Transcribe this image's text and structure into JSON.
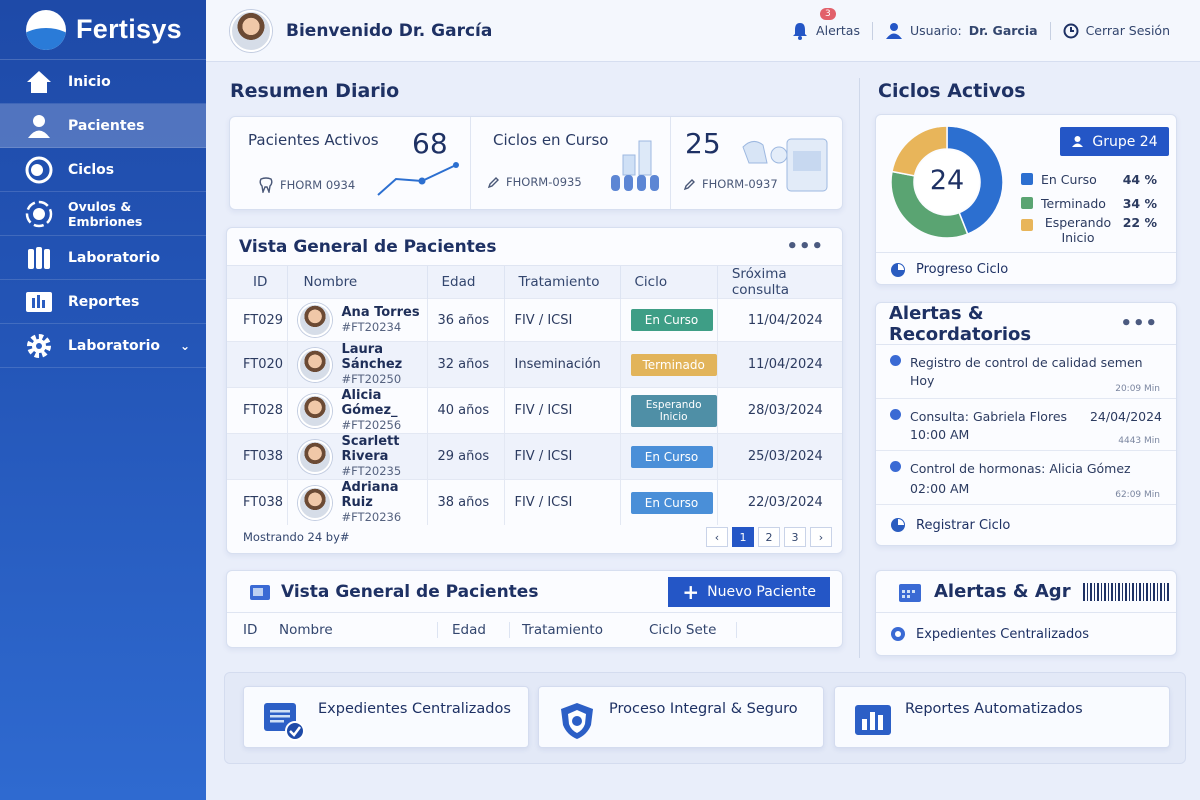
{
  "app": {
    "name": "Fertisys"
  },
  "sidebar": {
    "items": [
      {
        "label": "Inicio",
        "icon": "home-icon"
      },
      {
        "label": "Pacientes",
        "icon": "user-icon"
      },
      {
        "label": "Ciclos",
        "icon": "cycle-icon"
      },
      {
        "label": "Ovulos & Embriones",
        "icon": "embryo-icon"
      },
      {
        "label": "Laboratorio",
        "icon": "lab-icon"
      },
      {
        "label": "Reportes",
        "icon": "reports-icon"
      },
      {
        "label": "Laboratorio",
        "icon": "gear-icon"
      }
    ]
  },
  "header": {
    "welcome": "Bienvenido Dr. García",
    "alerts_label": "Alertas",
    "alerts_count": "3",
    "user_prefix": "Usuario:",
    "user_name": "Dr. Garcia",
    "logout": "Cerrar Sesión"
  },
  "summary": {
    "title": "Resumen Diario",
    "stats": [
      {
        "label": "Pacientes Activos",
        "value": "68",
        "code": "FHORM 0934"
      },
      {
        "label": "Ciclos en Curso",
        "value": "",
        "code": "FHORM-0935"
      },
      {
        "label": "",
        "value": "25",
        "code": "FHORM-0937"
      }
    ]
  },
  "patients": {
    "title": "Vista General de Pacientes",
    "columns": [
      "ID",
      "Nombre",
      "Edad",
      "Tratamiento",
      "Ciclo",
      "Sróxima consulta"
    ],
    "rows": [
      {
        "id": "FT029",
        "name": "Ana Torres",
        "code": "#FT20234",
        "age": "36 años",
        "treatment": "FIV / ICSI",
        "status": "En Curso",
        "date": "11/04/2024"
      },
      {
        "id": "FT020",
        "name": "Laura Sánchez",
        "code": "#FT20250",
        "age": "32 años",
        "treatment": "Inseminación",
        "status": "Terminado",
        "date": "11/04/2024"
      },
      {
        "id": "FT028",
        "name": "Alicia Gómez_",
        "code": "#FT20256",
        "age": "40 años",
        "treatment": "FIV / ICSI",
        "status": "Esperando Inicio",
        "date": "28/03/2024"
      },
      {
        "id": "FT038",
        "name": "Scarlett Rivera",
        "code": "#FT20235",
        "age": "29 años",
        "treatment": "FIV / ICSI",
        "status": "En Curso",
        "date": "25/03/2024"
      },
      {
        "id": "FT038",
        "name": "Adriana Ruiz",
        "code": "#FT20236",
        "age": "38 años",
        "treatment": "FIV / ICSI",
        "status": "En Curso",
        "date": "22/03/2024"
      }
    ],
    "footer": "Mostrando 24 by#",
    "pages": [
      "1",
      "2",
      "3"
    ]
  },
  "patients2": {
    "title": "Vista General de Pacientes",
    "new_button": "Nuevo Paciente",
    "columns": [
      "ID",
      "Nombre",
      "Edad",
      "Tratamiento",
      "Ciclo Sete"
    ]
  },
  "cycles": {
    "title": "Ciclos Activos",
    "group_button": "Grupe 24",
    "total": "24",
    "legend": [
      {
        "label": "En Curso",
        "pct": "44 %",
        "value": 44,
        "color": "#2c6fd0"
      },
      {
        "label": "Terminado",
        "pct": "34 %",
        "value": 34,
        "color": "#5aa472"
      },
      {
        "label": "Esperando Inicio",
        "pct": "22 %",
        "value": 22,
        "color": "#e8b55a"
      }
    ],
    "progress_link": "Progreso Ciclo"
  },
  "alerts": {
    "title": "Alertas & Recordatorios",
    "items": [
      {
        "text": "Registro de control de calidad semen",
        "sub": "Hoy",
        "date": "",
        "ago": "20:09 Min"
      },
      {
        "text": "Consulta: Gabriela Flores",
        "sub": "10:00 AM",
        "date": "24/04/2024",
        "ago": "4443 Min"
      },
      {
        "text": "Control de hormonas: Alicia Gómez",
        "sub": "02:00 AM",
        "date": "",
        "ago": "62:09 Min"
      }
    ],
    "register_link": "Registrar Ciclo"
  },
  "alerts2": {
    "title": "Alertas & Agr",
    "link": "Expedientes Centralizados"
  },
  "features": [
    {
      "label": "Expedientes Centralizados",
      "icon": "document-check-icon"
    },
    {
      "label": "Proceso Integral & Seguro",
      "icon": "shield-icon"
    },
    {
      "label": "Reportes Automatizados",
      "icon": "bar-chart-icon"
    }
  ],
  "colors": {
    "primary": "#2456c6",
    "status_en_curso": "#4a8fd8",
    "status_en_curso_first": "#3e9e86",
    "status_terminado": "#e2b45a",
    "status_esperando": "#4f8fa6"
  }
}
